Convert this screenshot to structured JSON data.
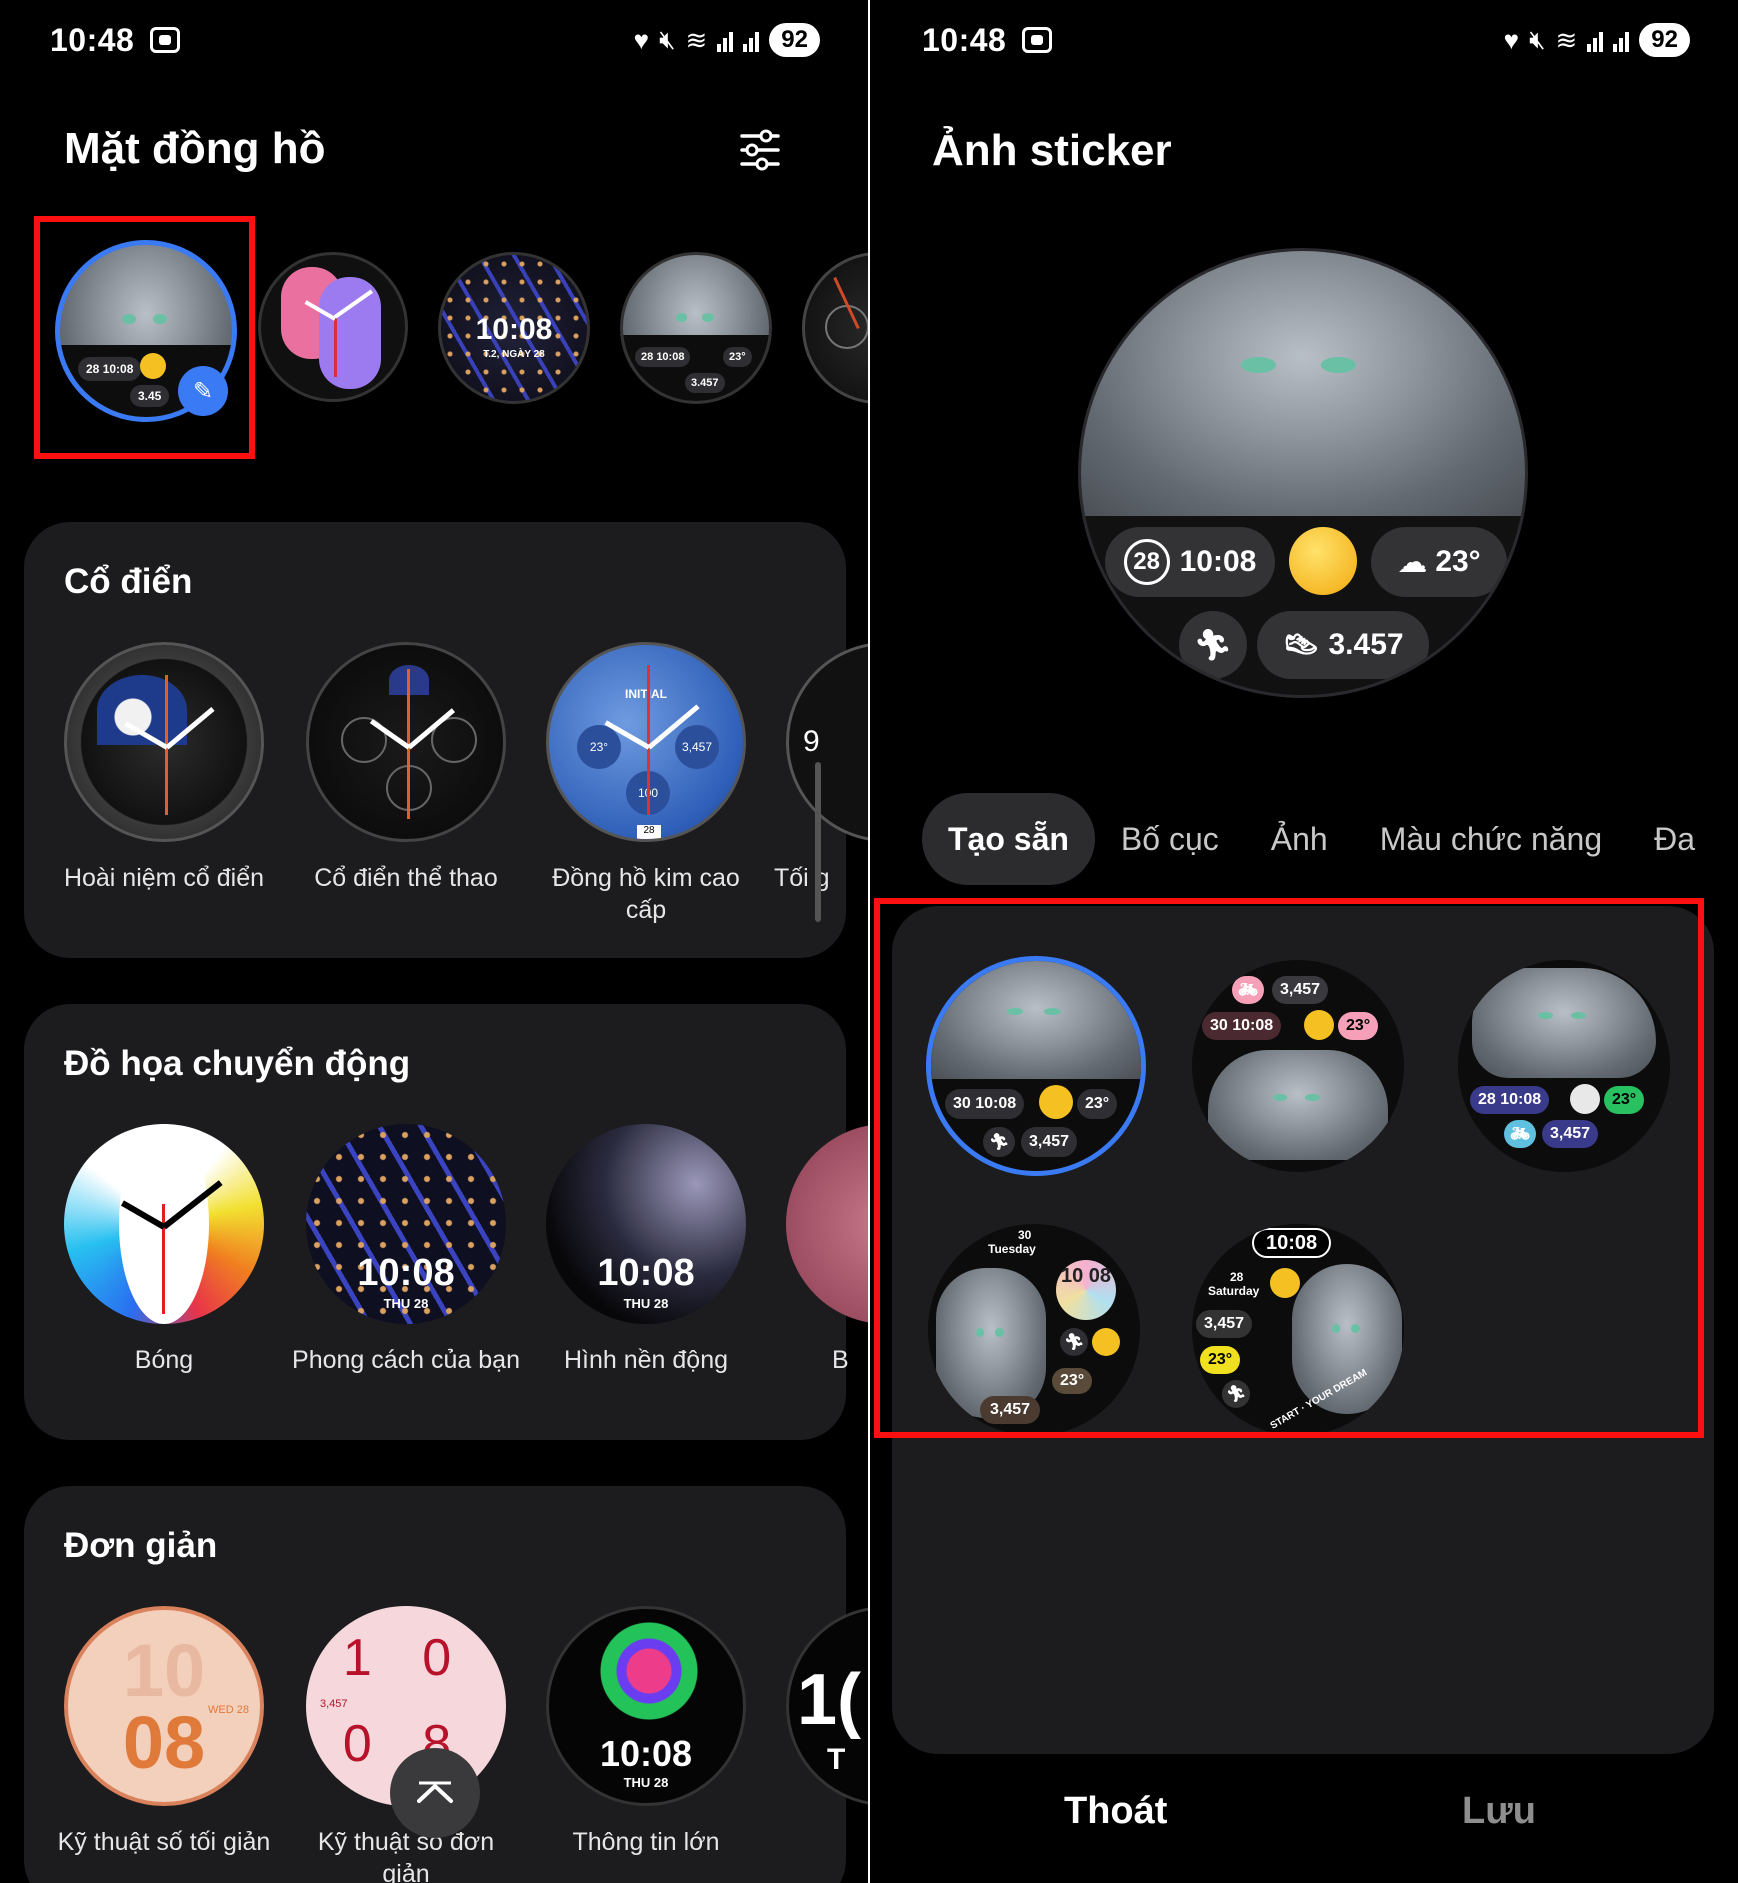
{
  "left": {
    "status": {
      "time": "10:48",
      "battery": "92"
    },
    "title": "Mặt đồng hồ",
    "top_faces": [
      {
        "name": "Ảnh sticker (selected)",
        "chips": [
          "28",
          "10:08",
          "3.45"
        ]
      },
      {
        "name": "Pink analog",
        "chips": []
      },
      {
        "name": "Pattern digital",
        "time": "10:08",
        "date": "T.2, NGÀY 28"
      },
      {
        "name": "Cat sticker 2",
        "chips": [
          "28",
          "10:08",
          "23°",
          "3.457"
        ]
      },
      {
        "name": "Partial analog",
        "chips": []
      }
    ],
    "sections": [
      {
        "title": "Cổ điển",
        "items": [
          {
            "label": "Hoài niệm cổ điển"
          },
          {
            "label": "Cổ điển thể thao"
          },
          {
            "label": "Đồng hồ kim cao cấp",
            "face_text": [
              "INITIAL",
              "23°",
              "3,457",
              "100",
              "28"
            ]
          },
          {
            "label": "Tối g",
            "face_text": [
              "9"
            ]
          }
        ]
      },
      {
        "title": "Đồ họa chuyển động",
        "items": [
          {
            "label": "Bóng"
          },
          {
            "label": "Phong cách của bạn",
            "time": "10:08",
            "date": "THU 28"
          },
          {
            "label": "Hình nền động",
            "time": "10:08",
            "date": "THU 28"
          },
          {
            "label": "B"
          }
        ]
      },
      {
        "title": "Đơn giản",
        "items": [
          {
            "label": "Kỹ thuật số tối giản",
            "face_text": [
              "10",
              "08",
              "WED 28"
            ]
          },
          {
            "label": "Kỹ thuật số đơn giản",
            "face_text": [
              "1 0",
              "0 8",
              "3,457"
            ]
          },
          {
            "label": "Thông tin lớn",
            "time": "10:08",
            "date": "THU 28"
          },
          {
            "label": "",
            "face_text": [
              "1(",
              "T"
            ]
          }
        ]
      }
    ]
  },
  "right": {
    "status": {
      "time": "10:48",
      "battery": "92"
    },
    "title": "Ảnh sticker",
    "preview": {
      "date": "28",
      "time": "10:08",
      "temp": "23°",
      "steps": "3.457"
    },
    "tabs": [
      "Tạo sẵn",
      "Bố cục",
      "Ảnh",
      "Màu chức năng",
      "Đa"
    ],
    "presets": [
      {
        "date": "30",
        "time": "10:08",
        "temp": "23°",
        "steps": "3,457"
      },
      {
        "date": "30",
        "time": "10:08",
        "temp": "23°",
        "steps": "3,457"
      },
      {
        "date": "28",
        "time": "10:08",
        "temp": "23°",
        "steps": "3,457"
      },
      {
        "date": "30",
        "day": "Tuesday",
        "time": "10 08",
        "temp": "23°",
        "steps": "3,457"
      },
      {
        "date": "28",
        "day": "Saturday",
        "time": "10:08",
        "temp": "23°",
        "steps": "3,457",
        "ring": "START · YOUR DREAM"
      }
    ],
    "exit_label": "Thoát",
    "save_label": "Lưu"
  },
  "colors": {
    "highlight": "#ff1010",
    "accent_blue": "#3a7bf5",
    "card": "#1c1c1e"
  }
}
